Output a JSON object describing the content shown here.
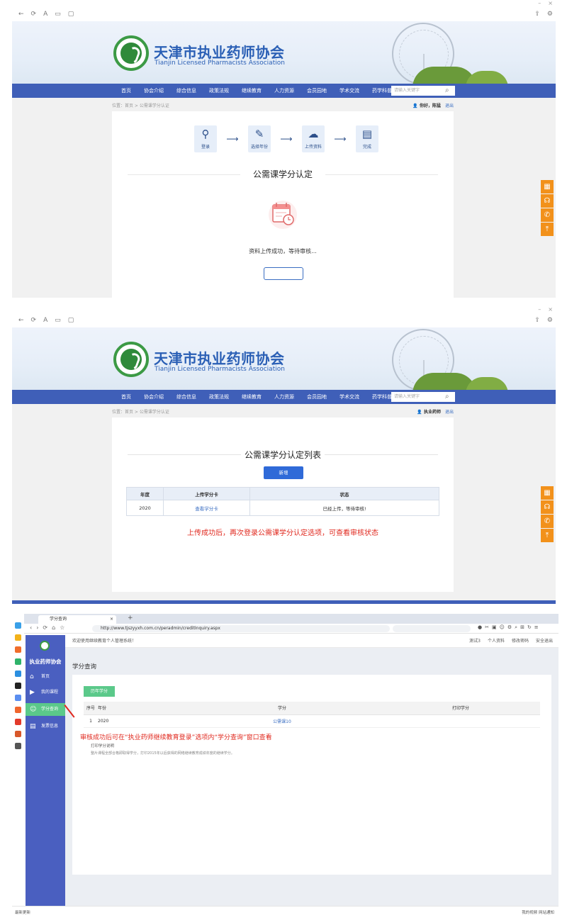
{
  "site": {
    "name_cn": "天津市执业药师协会",
    "name_en": "Tianjin Licensed Pharmacists Association"
  },
  "menu": {
    "items": [
      "首页",
      "协会介绍",
      "综合信息",
      "政策法规",
      "继续教育",
      "人力资源",
      "会员园地",
      "学术交流",
      "药学科普"
    ],
    "search_placeholder": "请输入关键字"
  },
  "panel1": {
    "breadcrumb": "位置：首页 > 公需课学分认证",
    "user": "你好，陈猛",
    "logout": "退出",
    "steps": [
      {
        "label": "登录",
        "icon": "user-icon"
      },
      {
        "label": "选择年份",
        "icon": "edit-icon"
      },
      {
        "label": "上传资料",
        "icon": "cloud-upload-icon"
      },
      {
        "label": "完成",
        "icon": "document-icon"
      }
    ],
    "title": "公需课学分认定",
    "message": "资料上传成功，等待审核..."
  },
  "panel2": {
    "breadcrumb": "位置：首页 > 公需课学分认证",
    "user": "执业药师",
    "logout": "退出",
    "title": "公需课学分认定列表",
    "add_button": "新增",
    "table": {
      "headers": [
        "年度",
        "上传学分卡",
        "状态"
      ],
      "rows": [
        [
          "2020",
          "查看学分卡",
          "已经上传，等待审核!"
        ]
      ]
    },
    "tip": "上传成功后，再次登录公需课学分认定选项，可查看审核状态"
  },
  "panel3": {
    "tab_title": "学分查询",
    "url": "http://www.tjszyyxh.com.cn/peradmin/creditInquiry.aspx",
    "sidebar_title": "执业药师协会",
    "sidebar_items": [
      "首页",
      "我的课程",
      "学分查询",
      "发票信息"
    ],
    "welcome": "欢迎使用继续教育个人管理系统！",
    "top_links": [
      "测试3",
      "个人资料",
      "修改密码",
      "安全退出"
    ],
    "page_title": "学分查询",
    "year_button": "历年学分",
    "table": {
      "headers": [
        "序号",
        "年份",
        "学分",
        "打印学分"
      ],
      "rows": [
        [
          "1",
          "2020",
          "公需课10",
          ""
        ]
      ]
    },
    "tip": "审核成功后可在“执业药师继续教育登录”选项内“学分查询”窗口查看",
    "print_title": "打印学分说明",
    "print_desc": "整片课程全部合格即取得学分，打印2015年以后获得的网络继续教育成绩年度的继续学分。",
    "status_left": "最新更新",
    "status_right": "我的视频  网站通知"
  },
  "colors": {
    "nav_blue": "#3f5fb8",
    "accent_blue": "#2f6ad8",
    "float_orange": "#f2911b",
    "tip_red": "#e0281e",
    "sidebar_blue": "#4a5fc0",
    "active_green": "#5bc98a"
  }
}
